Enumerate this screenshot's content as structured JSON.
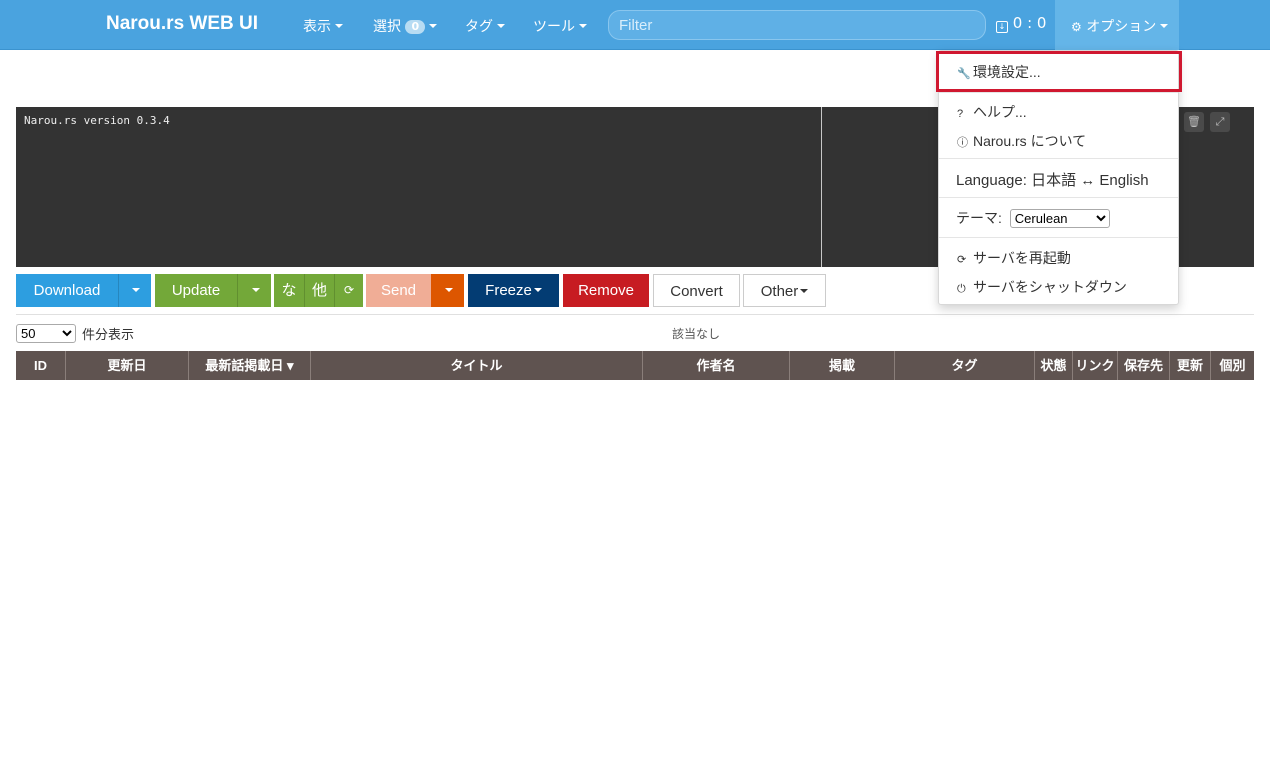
{
  "navbar": {
    "brand": "Narou.rs WEB UI",
    "menu_view": "表示",
    "menu_select": "選択",
    "select_count": "0",
    "menu_tag": "タグ",
    "menu_tool": "ツール",
    "filter_placeholder": "Filter",
    "queue_status": "0 : 0",
    "menu_options": "オプション"
  },
  "console": {
    "text": "Narou.rs version 0.3.4"
  },
  "toolbar": {
    "download": "Download",
    "update": "Update",
    "na": "な",
    "hoka": "他",
    "send": "Send",
    "freeze": "Freeze",
    "remove": "Remove",
    "convert": "Convert",
    "other": "Other"
  },
  "list": {
    "per_page_value": "50",
    "per_page_label": "件分表示",
    "no_result": "該当なし"
  },
  "table": {
    "columns": [
      "ID",
      "更新日",
      "最新話掲載日 ▾",
      "タイトル",
      "作者名",
      "掲載",
      "タグ",
      "状態",
      "リンク",
      "保存先",
      "更新",
      "個別"
    ]
  },
  "options_menu": {
    "settings": "環境設定...",
    "help": "ヘルプ...",
    "about": "Narou.rs について",
    "language": "Language: 日本語 ↔ English",
    "theme_label": "テーマ:",
    "theme_value": "Cerulean",
    "restart": "サーバを再起動",
    "shutdown": "サーバをシャットダウン"
  },
  "colors": {
    "navbar": "#4aa3df",
    "console_bg": "#333333",
    "table_header": "#5f5350",
    "highlight": "#d01830"
  }
}
